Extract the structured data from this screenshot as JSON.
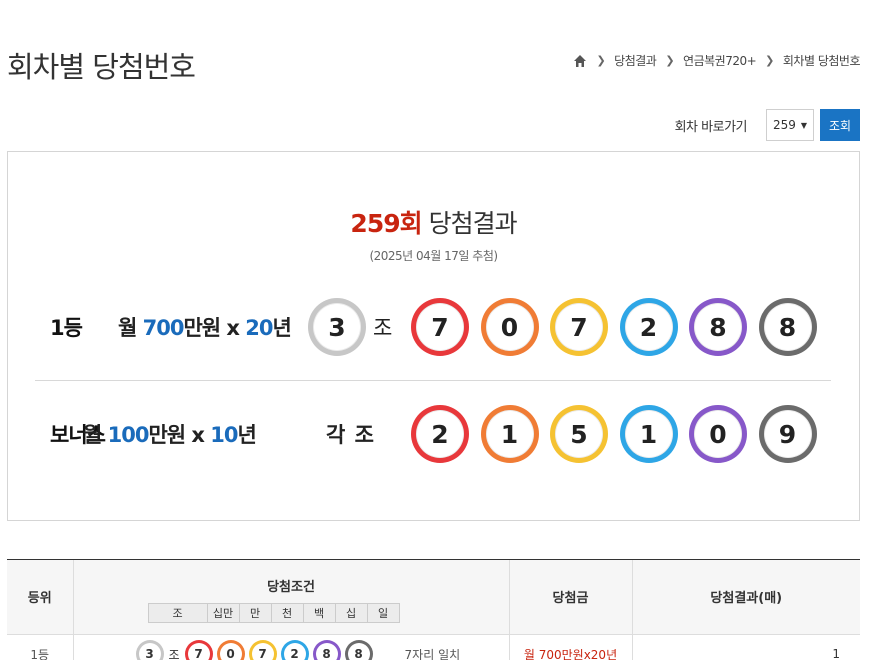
{
  "header": {
    "title": "회차별 당첨번호",
    "breadcrumb": [
      "당첨결과",
      "연금복권720+",
      "회차별 당첨번호"
    ]
  },
  "goto": {
    "label": "회차 바로가기",
    "selected_round": "259",
    "search_label": "조회"
  },
  "result": {
    "round_label": "259회",
    "title_suffix": "당첨결과",
    "draw_date": "(2025년 04월 17일 추첨)",
    "first": {
      "rank_label": "1등",
      "amount_prefix": "월 ",
      "amount_value": "700",
      "amount_unit": "만원 x ",
      "years_value": "20",
      "years_unit": "년",
      "group": "3",
      "group_suffix": "조",
      "numbers": [
        "7",
        "0",
        "7",
        "2",
        "8",
        "8"
      ]
    },
    "bonus": {
      "rank_label": "보너스",
      "amount_prefix": "월 ",
      "amount_value": "100",
      "amount_unit": "만원 x ",
      "years_value": "10",
      "years_unit": "년",
      "group_label": "각 조",
      "numbers": [
        "2",
        "1",
        "5",
        "1",
        "0",
        "9"
      ]
    }
  },
  "ball_colors": [
    "#e8383b",
    "#f07c35",
    "#f5c232",
    "#2ea6e6",
    "#8758c9",
    "#6b6b6b"
  ],
  "group_ball_color": "#c7c7c7",
  "table": {
    "headers": {
      "rank": "등위",
      "condition": "당첨조건",
      "prize": "당첨금",
      "count": "당첨결과(매)"
    },
    "sub_headers": [
      "조",
      "십만",
      "만",
      "천",
      "백",
      "십",
      "일"
    ],
    "row1": {
      "rank": "1등",
      "group": "3",
      "group_suffix": "조",
      "numbers": [
        "7",
        "0",
        "7",
        "2",
        "8",
        "8"
      ],
      "condition_text": "7자리 일치",
      "prize": "월 700만원x20년",
      "count": "1"
    }
  }
}
